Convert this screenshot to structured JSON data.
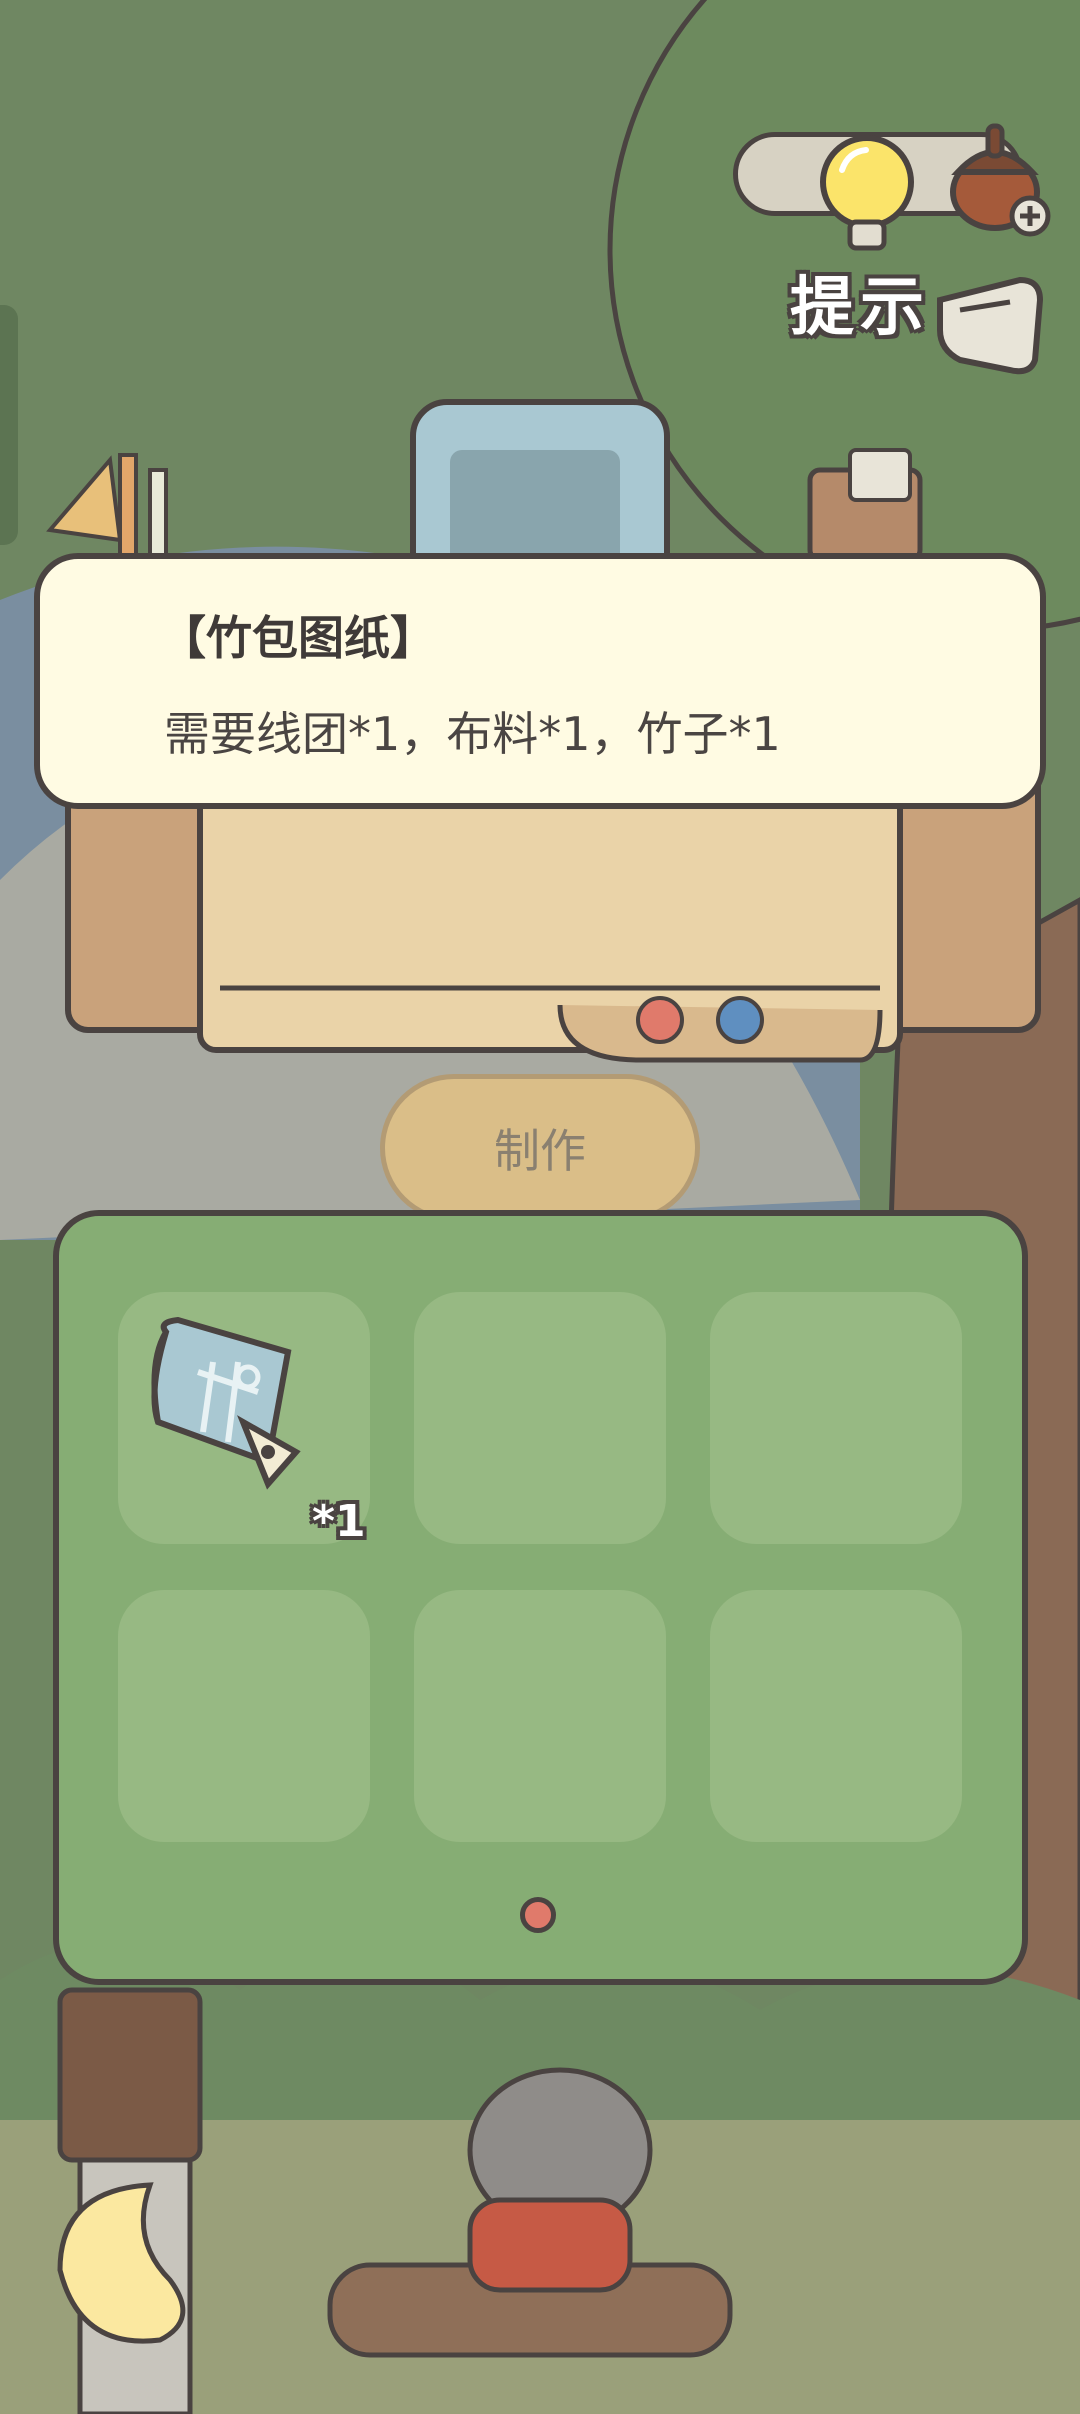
{
  "hint": {
    "label": "提示",
    "icon_bulb": "lightbulb-icon",
    "icon_acorn": "acorn-plus-icon",
    "icon_hand": "pointing-hand-icon"
  },
  "recipe": {
    "title": "【竹包图纸】",
    "requirement": "需要线团*1，布料*1，竹子*1"
  },
  "craft_button": {
    "label": "制作"
  },
  "inventory": {
    "slots": [
      {
        "item_icon": "blueprint-icon",
        "count": "*1"
      },
      {
        "item_icon": "",
        "count": ""
      },
      {
        "item_icon": "",
        "count": ""
      },
      {
        "item_icon": "",
        "count": ""
      },
      {
        "item_icon": "",
        "count": ""
      },
      {
        "item_icon": "",
        "count": ""
      }
    ],
    "current_page": 1,
    "page_count": 1
  },
  "colors": {
    "outline": "#4a4341",
    "card_bg": "#fffbe3",
    "panel_bg": "#86ad74",
    "slot_bg": "#97b983",
    "craft_button_bg": "#e8c480",
    "page_dot": "#e07a6b"
  }
}
